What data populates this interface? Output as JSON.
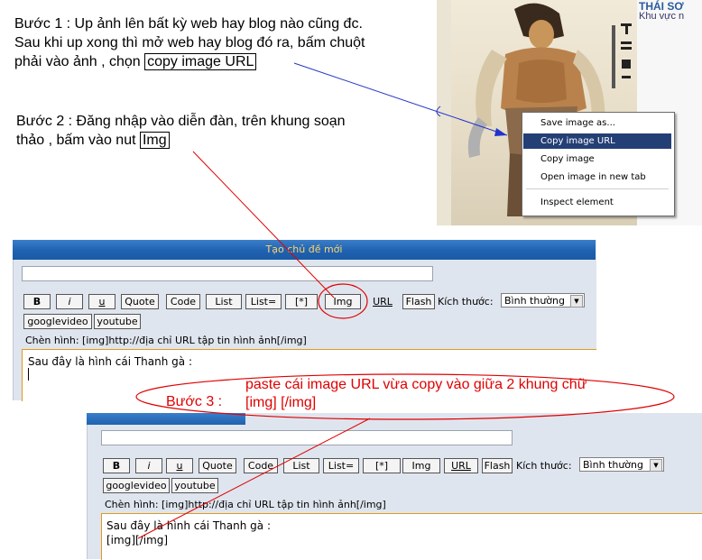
{
  "instructions": {
    "step1_line1": "Bước 1 : Up ảnh lên bất kỳ web hay blog nào cũng đc.",
    "step1_line2": "Sau khi up xong thì mở web hay blog đó ra, bấm chuột",
    "step1_line3_prefix": "phải vào ảnh , chọn",
    "step1_highlight": "copy image URL",
    "step2_line1": "Bước 2 : Đăng nhập vào diễn đàn, trên khung soạn",
    "step2_line2_prefix": "thảo , bấm vào nut",
    "step2_highlight": "Img",
    "step3_label": "Bước 3 :",
    "step3_text_line1": "paste cái image URL vừa copy vào giữa 2 khung chữ",
    "step3_text_line2": "[img] [/img]"
  },
  "browser_side": {
    "site_title": "THÁI SƠ",
    "site_sub": "Khu vực n",
    "context_menu": {
      "items": [
        "Save image as...",
        "Copy image URL",
        "Copy image",
        "Open image in new tab",
        "Inspect element"
      ],
      "selected": "Copy image URL"
    }
  },
  "editor_top": {
    "title": "Tạo chủ đề mới",
    "subject_value": "",
    "toolbar_row1": [
      "B",
      "i",
      "u",
      "Quote",
      "Code",
      "List",
      "List=",
      "[*]",
      "Img",
      "URL",
      "Flash"
    ],
    "size_label": "Kích thước:",
    "size_value": "Bình thường",
    "toolbar_row2": [
      "googlevideo",
      "youtube"
    ],
    "hint": "Chèn hình: [img]http://địa chỉ URL tập tin hình ảnh[/img]",
    "content_line1": "Sau đây là hình cái Thanh gà :"
  },
  "editor_bottom": {
    "subject_value": "",
    "toolbar_row1": [
      "B",
      "i",
      "u",
      "Quote",
      "Code",
      "List",
      "List=",
      "[*]",
      "Img",
      "URL",
      "Flash"
    ],
    "size_label": "Kích thước:",
    "size_value": "Bình thường",
    "toolbar_row2": [
      "googlevideo",
      "youtube"
    ],
    "hint": "Chèn hình: [img]http://địa chỉ URL tập tin hình ảnh[/img]",
    "content_line1": "Sau đây là hình cái Thanh gà :",
    "content_line2": "[img][/img]"
  },
  "colors": {
    "annotation_red": "#e00000",
    "menu_highlight": "#243f75",
    "title_bar_blue": "#1f62b0",
    "title_text": "#ffd36b",
    "editor_border": "#e09a1c"
  }
}
